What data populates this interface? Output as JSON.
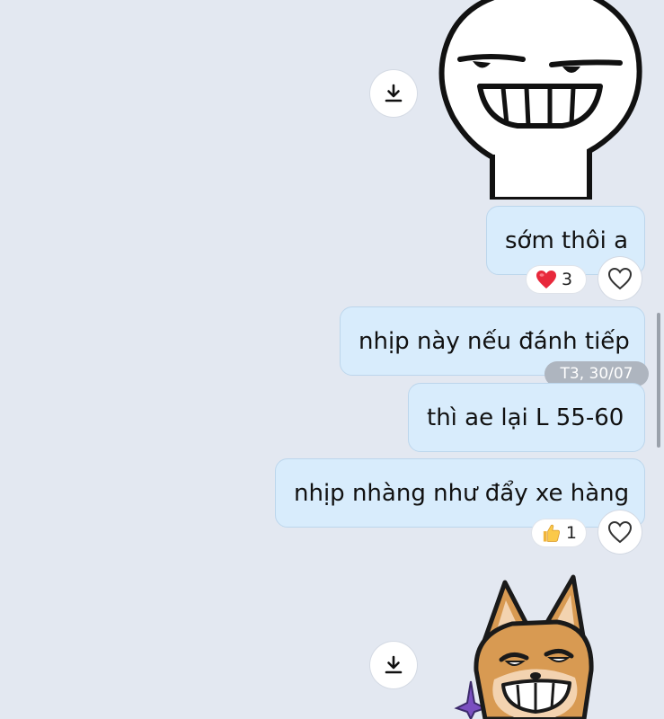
{
  "chat": {
    "messages": [
      {
        "text": "sớm thôi a",
        "reaction": {
          "icon": "heart-emoji",
          "count": "3"
        }
      },
      {
        "text": "nhịp này nếu đánh tiếp"
      },
      {
        "text": "thì ae lại L 55-60"
      },
      {
        "text": "nhịp nhàng như đẩy xe hàng",
        "reaction": {
          "icon": "thumbs-up-emoji",
          "count": "1"
        }
      }
    ],
    "timestamp": "T3, 30/07",
    "stickers": [
      {
        "name": "grinning-stick-figure-sticker"
      },
      {
        "name": "grinning-fox-sticker"
      }
    ]
  },
  "colors": {
    "background": "#e3e8f1",
    "bubble": "#d8ecfc",
    "bubble_border": "#bcd6ec",
    "timestamp_pill": "#aeb5bf",
    "fox": "#d89a52"
  },
  "icons": {
    "download": "download-icon",
    "like": "heart-outline-icon"
  }
}
